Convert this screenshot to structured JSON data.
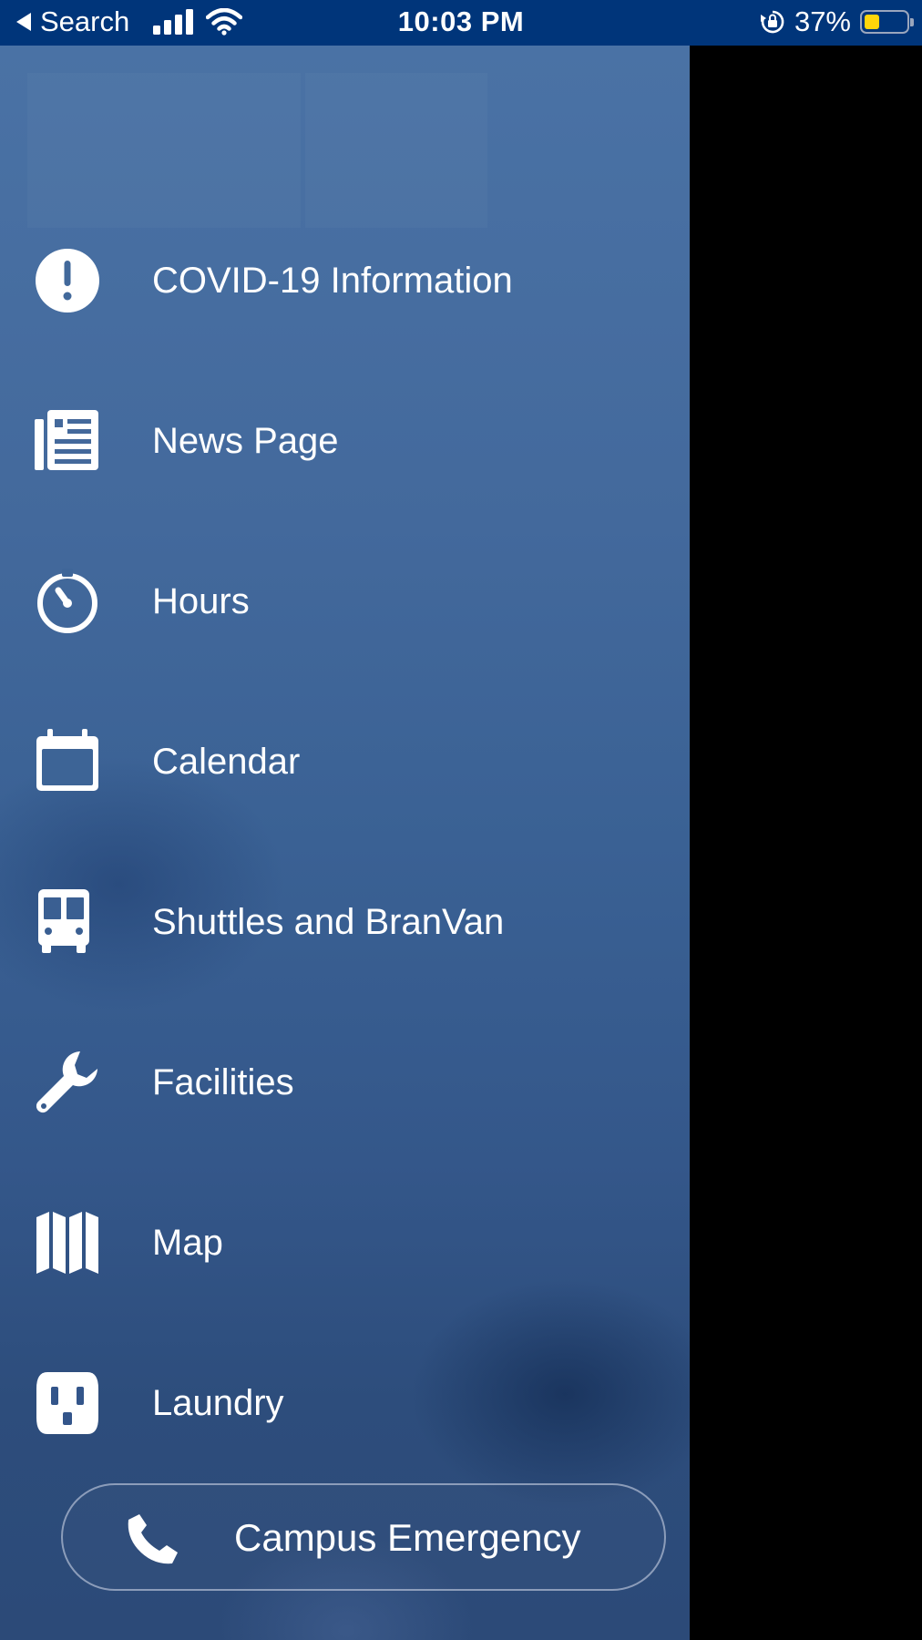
{
  "status_bar": {
    "back_label": "Search",
    "time": "10:03 PM",
    "battery_percent": "37%",
    "battery_level": 0.37,
    "colors": {
      "background": "#00357a",
      "battery_fill": "#ffd60a"
    }
  },
  "drawer": {
    "items": [
      {
        "label": "COVID-19 Information",
        "icon": "alert-circle-icon"
      },
      {
        "label": "News Page",
        "icon": "newspaper-icon"
      },
      {
        "label": "Hours",
        "icon": "timer-icon"
      },
      {
        "label": "Calendar",
        "icon": "calendar-icon"
      },
      {
        "label": "Shuttles and BranVan",
        "icon": "bus-icon"
      },
      {
        "label": "Facilities",
        "icon": "wrench-icon"
      },
      {
        "label": "Map",
        "icon": "map-icon"
      },
      {
        "label": "Laundry",
        "icon": "outlet-icon"
      }
    ],
    "emergency_button": {
      "label": "Campus Emergency",
      "icon": "phone-icon"
    }
  }
}
